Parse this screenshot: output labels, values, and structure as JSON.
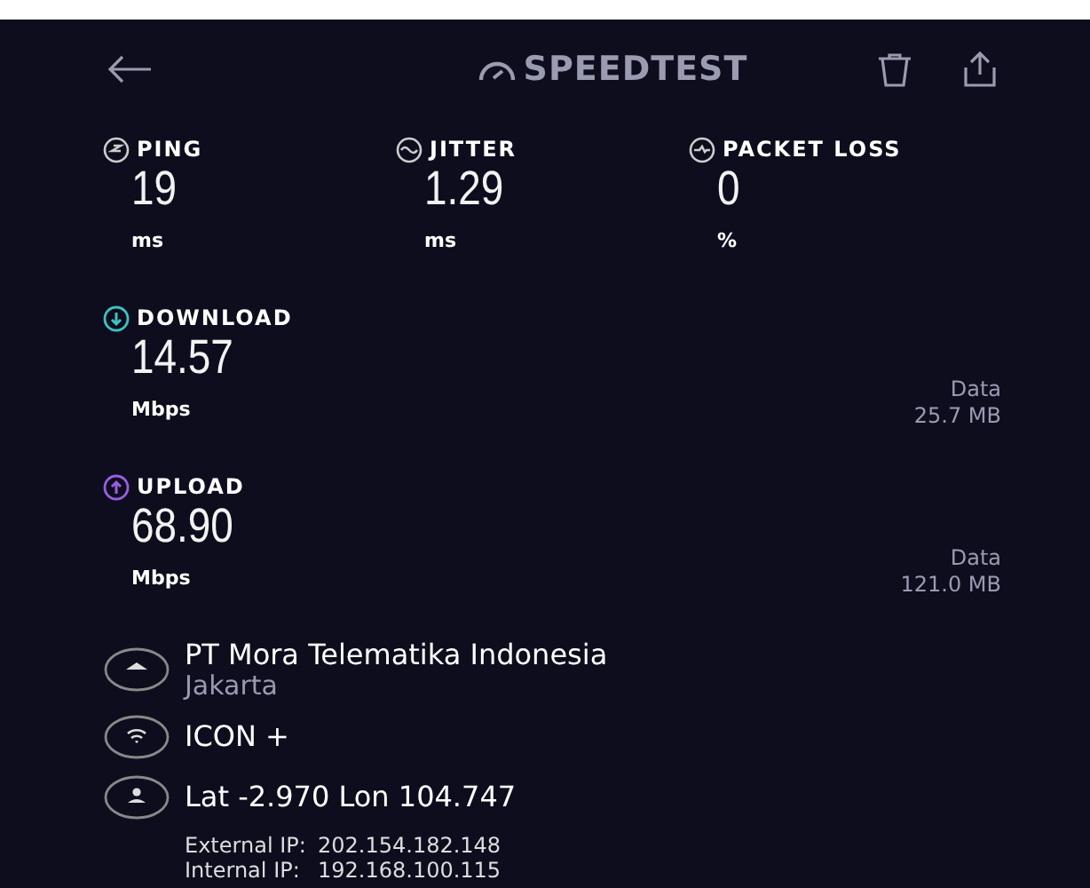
{
  "header": {
    "logo": "SPEEDTEST"
  },
  "metrics": [
    {
      "kind": "ping",
      "label": "PING",
      "value": "19",
      "unit": "ms"
    },
    {
      "kind": "jitter",
      "label": "JITTER",
      "value": "1.29",
      "unit": "ms"
    },
    {
      "kind": "loss",
      "label": "PACKET LOSS",
      "value": "0",
      "unit": "%"
    }
  ],
  "results": [
    {
      "kind": "download",
      "label": "DOWNLOAD",
      "color": "#3fc1c0",
      "value": "14.57",
      "unit": "Mbps",
      "data_label": "Data",
      "data_value": "25.7 MB"
    },
    {
      "kind": "upload",
      "label": "UPLOAD",
      "color": "#9a5ee0",
      "value": "68.90",
      "unit": "Mbps",
      "data_label": "Data",
      "data_value": "121.0 MB"
    }
  ],
  "details": [
    {
      "kind": "server",
      "title": "PT Mora Telematika Indonesia",
      "subtitle": "Jakarta"
    },
    {
      "kind": "wifi",
      "title": "ICON +"
    },
    {
      "kind": "location",
      "title": "Lat -2.970 Lon 104.747"
    }
  ],
  "ips": [
    {
      "label": "External IP:",
      "value": "202.154.182.148"
    },
    {
      "label": "Internal IP:",
      "value": "192.168.100.115"
    }
  ]
}
